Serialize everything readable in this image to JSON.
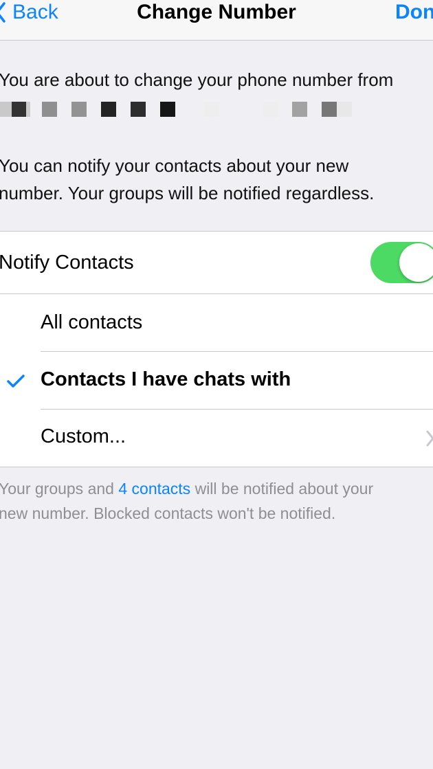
{
  "nav": {
    "back_label": "Back",
    "title": "Change Number",
    "done_label": "Done"
  },
  "intro": {
    "text": "You are about to change your phone number from"
  },
  "masked_number_colors": [
    "#c9c9c9",
    "#333333",
    "#cccccc",
    "#8f8f8f",
    "#939393",
    "#242424",
    "#2d2d2d",
    "#161616",
    "#eeeeee",
    "#eeeeee",
    "#e8e8e8",
    "#a2a2a2",
    "#777777",
    "#e8e8e8"
  ],
  "notice": {
    "line1": "You can notify your contacts about your new",
    "line2": "number. Your groups will be notified regardless."
  },
  "notify": {
    "label": "Notify Contacts",
    "enabled": true,
    "toggle_color": "#4cd964"
  },
  "options": [
    {
      "label": "All contacts",
      "selected": false
    },
    {
      "label": "Contacts I have chats with",
      "selected": true
    },
    {
      "label": "Custom...",
      "selected": false
    }
  ],
  "footer": {
    "prefix": "Your groups and ",
    "link": "4 contacts",
    "suffix": " will be notified about your",
    "line2": "new number. Blocked contacts won't be notified."
  },
  "colors": {
    "accent": "#0a84ff",
    "background": "#efeff4",
    "secondary_text": "#8e8e93"
  }
}
